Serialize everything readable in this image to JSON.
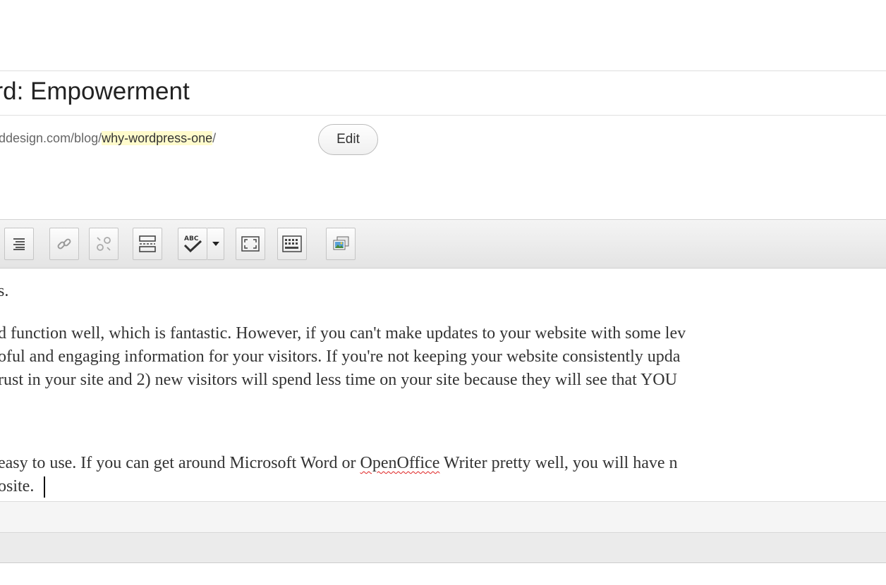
{
  "post": {
    "title": "ord:  Empowerment",
    "permalink_base": "ddesign.com/blog/",
    "permalink_slug": "why-wordpress-one",
    "permalink_suffix": "/",
    "edit_label": "Edit"
  },
  "toolbar": {
    "buttons": [
      "align-justify-icon",
      "insert-link-icon",
      "unlink-icon",
      "insert-more-icon",
      "spellcheck-icon",
      "fullscreen-icon",
      "kitchen-sink-icon",
      "add-media-icon"
    ]
  },
  "editor": {
    "line_1": "s.",
    "line_2": "d function well, which is fantastic.  However, if you can't make updates to your website with some lev",
    "line_3": "oful and engaging information for your visitors.  If you're not keeping your website consistently upda",
    "line_4": "rust in your site and 2) new visitors will spend less time on your site because they will see that YOU",
    "line_5_before": "easy to use.   If you can get around Microsoft Word or ",
    "line_5_misspelled": "OpenOffice",
    "line_5_after": " Writer pretty well, you will have n",
    "line_6": "osite."
  }
}
